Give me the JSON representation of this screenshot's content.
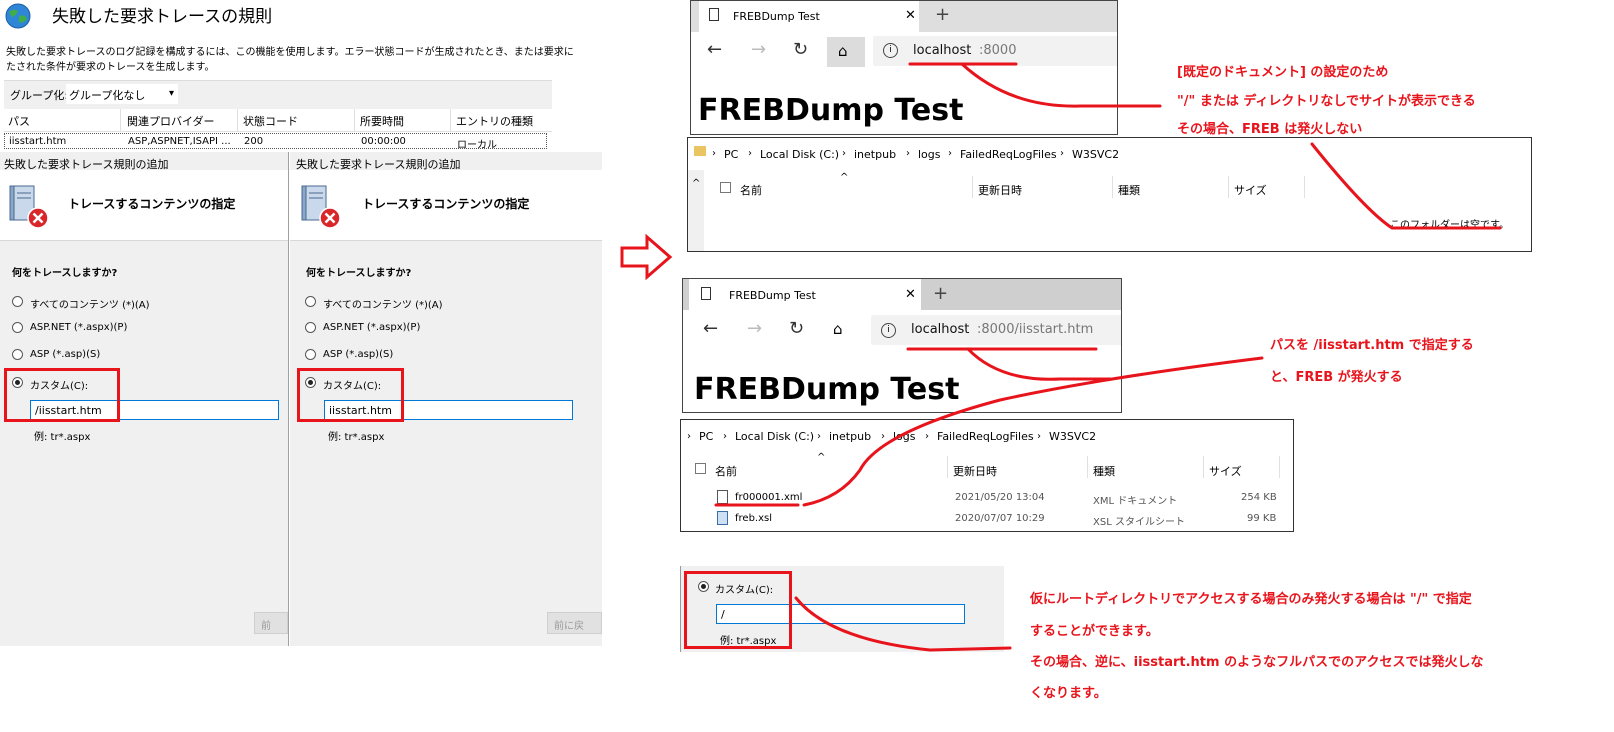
{
  "iis": {
    "title": "失敗した要求トレースの規則",
    "description_line1": "失敗した要求トレースのログ記録を構成するには、この機能を使用します。エラー状態コードが生成されたとき、または要求に",
    "description_line2": "たされた条件が要求のトレースを生成します。",
    "group_label": "グループ化:",
    "group_value": "グループ化なし",
    "columns": [
      "パス",
      "関連プロバイダー",
      "状態コード",
      "所要時間",
      "エントリの種類"
    ],
    "row": [
      "iisstart.htm",
      "ASP,ASPNET,ISAPI ...",
      "200",
      "00:00:00",
      "ローカル"
    ]
  },
  "wizard_left": {
    "title": "失敗した要求トレース規則の追加",
    "heading": "トレースするコンテンツの指定",
    "question": "何をトレースしますか?",
    "options": [
      "すべてのコンテンツ (*)(A)",
      "ASP.NET (*.aspx)(P)",
      "ASP (*.asp)(S)",
      "カスタム(C):"
    ],
    "custom_value": "/iisstart.htm",
    "example": "例: tr*.aspx",
    "button": "前"
  },
  "wizard_right": {
    "title": "失敗した要求トレース規則の追加",
    "heading": "トレースするコンテンツの指定",
    "question": "何をトレースしますか?",
    "options": [
      "すべてのコンテンツ (*)(A)",
      "ASP.NET (*.aspx)(P)",
      "ASP (*.asp)(S)",
      "カスタム(C):"
    ],
    "custom_value": "iisstart.htm",
    "example": "例: tr*.aspx",
    "button": "前に戻"
  },
  "browser1": {
    "tab_title": "FREBDump Test",
    "url_host": "localhost",
    "url_rest": ":8000",
    "page_heading": "FREBDump Test"
  },
  "explorer1": {
    "path": [
      "PC",
      "Local Disk (C:)",
      "inetpub",
      "logs",
      "FailedReqLogFiles",
      "W3SVC2"
    ],
    "columns": [
      "名前",
      "更新日時",
      "種類",
      "サイズ"
    ],
    "empty_text": "このフォルダーは空です。"
  },
  "browser2": {
    "tab_title": "FREBDump Test",
    "url_host": "localhost",
    "url_rest": ":8000/iisstart.htm",
    "page_heading": "FREBDump Test"
  },
  "explorer2": {
    "path": [
      "PC",
      "Local Disk (C:)",
      "inetpub",
      "logs",
      "FailedReqLogFiles",
      "W3SVC2"
    ],
    "columns": [
      "名前",
      "更新日時",
      "種類",
      "サイズ"
    ],
    "files": [
      {
        "name": "fr000001.xml",
        "date": "2021/05/20 13:04",
        "type": "XML ドキュメント",
        "size": "254 KB"
      },
      {
        "name": "freb.xsl",
        "date": "2020/07/07 10:29",
        "type": "XSL スタイルシート",
        "size": "99 KB"
      }
    ]
  },
  "custom_crop": {
    "label": "カスタム(C):",
    "value": "/",
    "example": "例: tr*.aspx"
  },
  "notes": {
    "note1_line1": "[既定のドキュメント] の設定のため",
    "note1_line2": "\"/\" または ディレクトリなしでサイトが表示できる",
    "note1_line3": "その場合、FREB は発火しない",
    "note2_line1": "パスを /iisstart.htm で指定する",
    "note2_line2": "と、FREB が発火する",
    "note3_line1": "仮にルートディレクトリでアクセスする場合のみ発火する場合は \"/\" で指定",
    "note3_line2": "することができます。",
    "note3_line3": "その場合、逆に、iisstart.htm のようなフルパスでのアクセスでは発火しな",
    "note3_line4": "くなります。"
  },
  "colors": {
    "annotation_red": "#e8141c",
    "focus_blue": "#0078d7"
  }
}
